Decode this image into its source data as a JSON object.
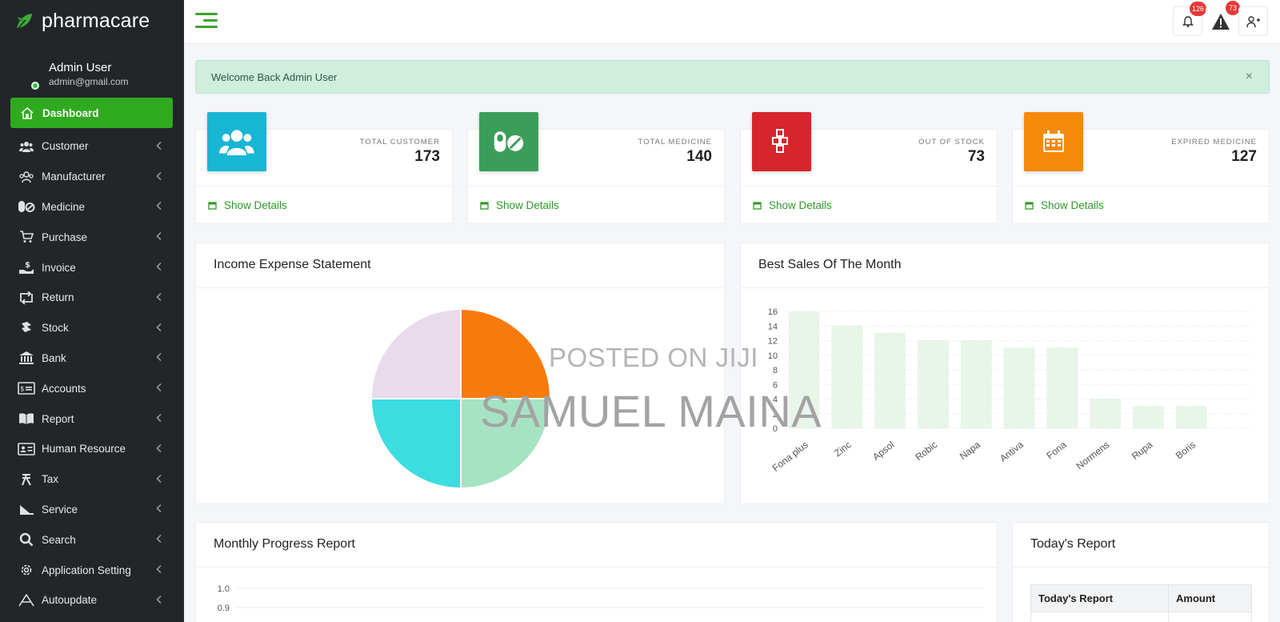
{
  "brand": {
    "name": "pharmacare"
  },
  "user": {
    "name": "Admin User",
    "email": "admin@gmail.com"
  },
  "nav": [
    {
      "label": "Dashboard",
      "icon": "home-icon",
      "active": true
    },
    {
      "label": "Customer",
      "icon": "users-icon"
    },
    {
      "label": "Manufacturer",
      "icon": "manufacturer-icon"
    },
    {
      "label": "Medicine",
      "icon": "pills-icon"
    },
    {
      "label": "Purchase",
      "icon": "cart-icon"
    },
    {
      "label": "Invoice",
      "icon": "hand-dollar-icon"
    },
    {
      "label": "Return",
      "icon": "retweet-icon"
    },
    {
      "label": "Stock",
      "icon": "stock-icon"
    },
    {
      "label": "Bank",
      "icon": "bank-icon"
    },
    {
      "label": "Accounts",
      "icon": "money-check-icon"
    },
    {
      "label": "Report",
      "icon": "book-icon"
    },
    {
      "label": "Human Resource",
      "icon": "id-card-icon"
    },
    {
      "label": "Tax",
      "icon": "tax-icon"
    },
    {
      "label": "Service",
      "icon": "service-icon"
    },
    {
      "label": "Search",
      "icon": "search-icon"
    },
    {
      "label": "Application Setting",
      "icon": "gear-icon"
    },
    {
      "label": "Autoupdate",
      "icon": "autoupdate-icon"
    }
  ],
  "topbar": {
    "notifications_count": "126",
    "alerts_count": "73"
  },
  "alert": {
    "message": "Welcome Back Admin User",
    "close": "×"
  },
  "stats": [
    {
      "label": "TOTAL CUSTOMER",
      "value": "173",
      "link": "Show Details",
      "color": "#17b6d4",
      "icon": "users-icon"
    },
    {
      "label": "TOTAL MEDICINE",
      "value": "140",
      "link": "Show Details",
      "color": "#3a9e5a",
      "icon": "pills-icon"
    },
    {
      "label": "OUT OF STOCK",
      "value": "73",
      "link": "Show Details",
      "color": "#d6262c",
      "icon": "cubes-icon"
    },
    {
      "label": "EXPIRED MEDICINE",
      "value": "127",
      "link": "Show Details",
      "color": "#f58a0b",
      "icon": "calendar-icon"
    }
  ],
  "panels": {
    "income": {
      "title": "Income Expense Statement"
    },
    "best_sales": {
      "title": "Best Sales Of The Month"
    },
    "monthly": {
      "title": "Monthly Progress Report"
    },
    "today": {
      "title": "Today's Report",
      "columns": [
        "Today's Report",
        "Amount"
      ]
    }
  },
  "watermark": {
    "line1": "POSTED ON JIJI",
    "line2": "SAMUEL MAINA"
  },
  "chart_data": [
    {
      "type": "pie",
      "title": "Income Expense Statement",
      "values": [
        25,
        25,
        25,
        25
      ],
      "colors": [
        "#f77b0c",
        "#a6e3c2",
        "#3bdde0",
        "#e8dcec"
      ]
    },
    {
      "type": "bar",
      "title": "Best Sales Of The Month",
      "categories": [
        "Fona plus",
        "Zinc",
        "Apsol",
        "Robic",
        "Napa",
        "Antiva",
        "Fona",
        "Normens",
        "Rupa",
        "Boris"
      ],
      "values": [
        16,
        14,
        13,
        12,
        12,
        11,
        11,
        4,
        3,
        3
      ],
      "ylim": [
        0,
        16
      ],
      "yticks": [
        0,
        2,
        4,
        6,
        8,
        10,
        12,
        14,
        16
      ],
      "bar_color": "#e8f5e9"
    },
    {
      "type": "line",
      "title": "Monthly Progress Report",
      "yticks_visible": [
        "1.0",
        "0.9"
      ]
    }
  ]
}
